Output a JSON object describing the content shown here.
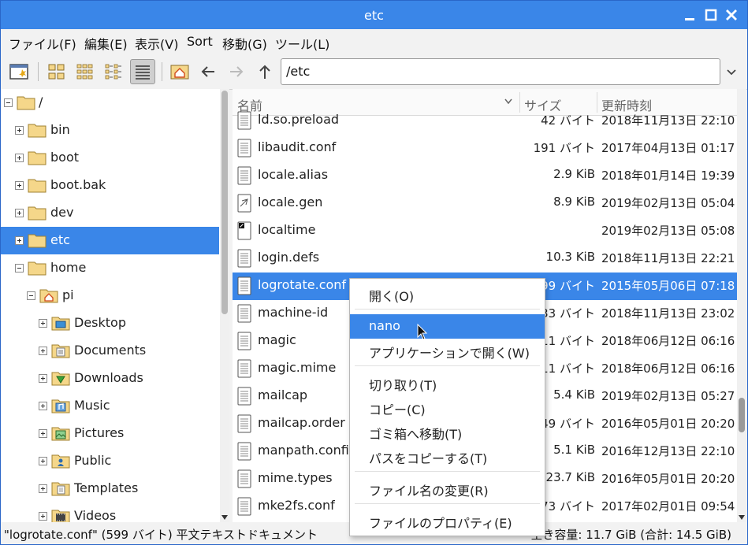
{
  "window": {
    "title": "etc"
  },
  "menubar": [
    "ファイル(F)",
    "編集(E)",
    "表示(V)",
    "Sort",
    "移動(G)",
    "ツール(L)"
  ],
  "toolbar": {
    "path": "/etc"
  },
  "sidebar": {
    "items": [
      {
        "label": "/",
        "icon": "folder-icon"
      },
      {
        "label": "bin",
        "icon": "folder-icon"
      },
      {
        "label": "boot",
        "icon": "folder-icon"
      },
      {
        "label": "boot.bak",
        "icon": "folder-icon"
      },
      {
        "label": "dev",
        "icon": "folder-icon"
      },
      {
        "label": "etc",
        "icon": "folder-icon",
        "selected": true
      },
      {
        "label": "home",
        "icon": "folder-icon"
      },
      {
        "label": "pi",
        "icon": "home-folder-icon"
      },
      {
        "label": "Desktop",
        "icon": "desktop-folder-icon"
      },
      {
        "label": "Documents",
        "icon": "documents-folder-icon"
      },
      {
        "label": "Downloads",
        "icon": "downloads-folder-icon"
      },
      {
        "label": "Music",
        "icon": "music-folder-icon"
      },
      {
        "label": "Pictures",
        "icon": "pictures-folder-icon"
      },
      {
        "label": "Public",
        "icon": "public-folder-icon"
      },
      {
        "label": "Templates",
        "icon": "templates-folder-icon"
      },
      {
        "label": "Videos",
        "icon": "videos-folder-icon"
      }
    ]
  },
  "filelist": {
    "headers": {
      "name": "名前",
      "size": "サイズ",
      "modified": "更新時刻"
    },
    "rows": [
      {
        "name": "ld.so.preload",
        "size": "42 バイト",
        "modified": "2018年11月13日 22:10"
      },
      {
        "name": "libaudit.conf",
        "size": "191 バイト",
        "modified": "2017年04月13日 01:17"
      },
      {
        "name": "locale.alias",
        "size": "2.9 KiB",
        "modified": "2018年01月14日 19:39"
      },
      {
        "name": "locale.gen",
        "size": "8.9 KiB",
        "modified": "2019年02月13日 05:04"
      },
      {
        "name": "localtime",
        "size": "",
        "modified": "2019年02月13日 05:08"
      },
      {
        "name": "login.defs",
        "size": "10.3 KiB",
        "modified": "2018年11月13日 22:21"
      },
      {
        "name": "logrotate.conf",
        "size": "599 バイト",
        "modified": "2015年05月06日 07:18",
        "selected": true
      },
      {
        "name": "machine-id",
        "size": "33 バイト",
        "modified": "2018年11月13日 23:02"
      },
      {
        "name": "magic",
        "size": "111 バイト",
        "modified": "2018年06月12日 06:16"
      },
      {
        "name": "magic.mime",
        "size": "111 バイト",
        "modified": "2018年06月12日 06:16"
      },
      {
        "name": "mailcap",
        "size": "5.4 KiB",
        "modified": "2019年02月13日 05:27"
      },
      {
        "name": "mailcap.order",
        "size": "449 バイト",
        "modified": "2016年05月01日 20:20"
      },
      {
        "name": "manpath.config",
        "size": "5.1 KiB",
        "modified": "2016年12月13日 22:10"
      },
      {
        "name": "mime.types",
        "size": "23.7 KiB",
        "modified": "2016年05月01日 20:20"
      },
      {
        "name": "mke2fs.conf",
        "size": "573 バイト",
        "modified": "2017年02月01日 09:54"
      }
    ]
  },
  "context_menu": {
    "items": [
      "開く(O)",
      "nano",
      "アプリケーションで開く(W)",
      "切り取り(T)",
      "コピー(C)",
      "ゴミ箱へ移動(T)",
      "パスをコピーする(T)",
      "ファイル名の変更(R)",
      "ファイルのプロパティ(E)"
    ]
  },
  "status": {
    "left": "\"logrotate.conf\" (599 バイト) 平文テキストドキュメント",
    "right": "空き容量: 11.7 GiB (合計: 14.5 GiB)"
  },
  "colors": {
    "accent": "#3a86e8",
    "folder": "#f5d78a"
  }
}
